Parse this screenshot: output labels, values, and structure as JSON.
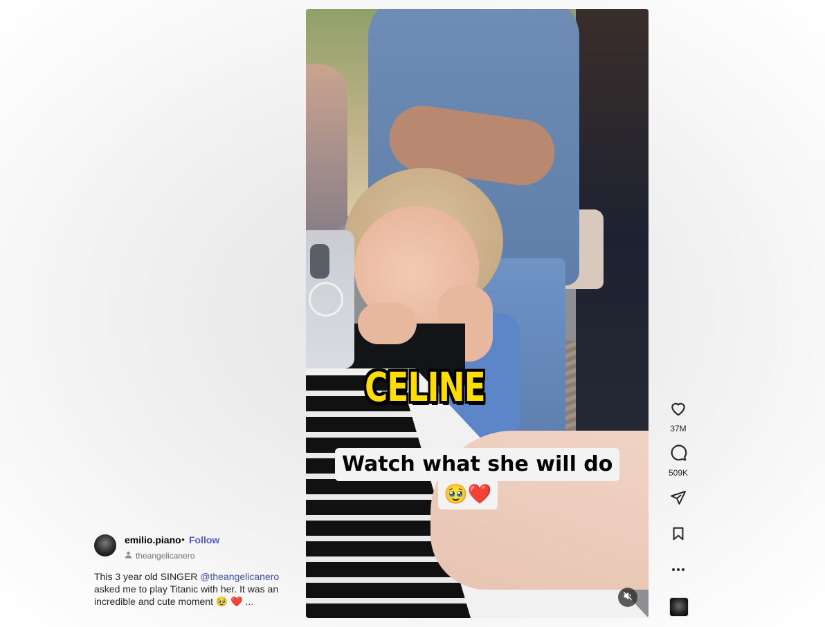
{
  "video": {
    "caption_title": "CELINE",
    "caption_text": "Watch what she will do",
    "caption_emoji": "🥹❤️"
  },
  "actions": {
    "like_count": "37M",
    "comment_count": "509K"
  },
  "post": {
    "username": "emilio.piano",
    "separator": "•",
    "follow_label": "Follow",
    "collaborator": "theangelicanero",
    "description_before": "This 3 year old SINGER ",
    "mention": "@theangelicanero",
    "description_after": " asked me to play Titanic with her. It was an incredible and cute moment 🥹 ❤️ ..."
  },
  "colors": {
    "follow": "#4f5bd5",
    "caption_title": "#ffdd00",
    "mention": "#3b4fb0"
  }
}
